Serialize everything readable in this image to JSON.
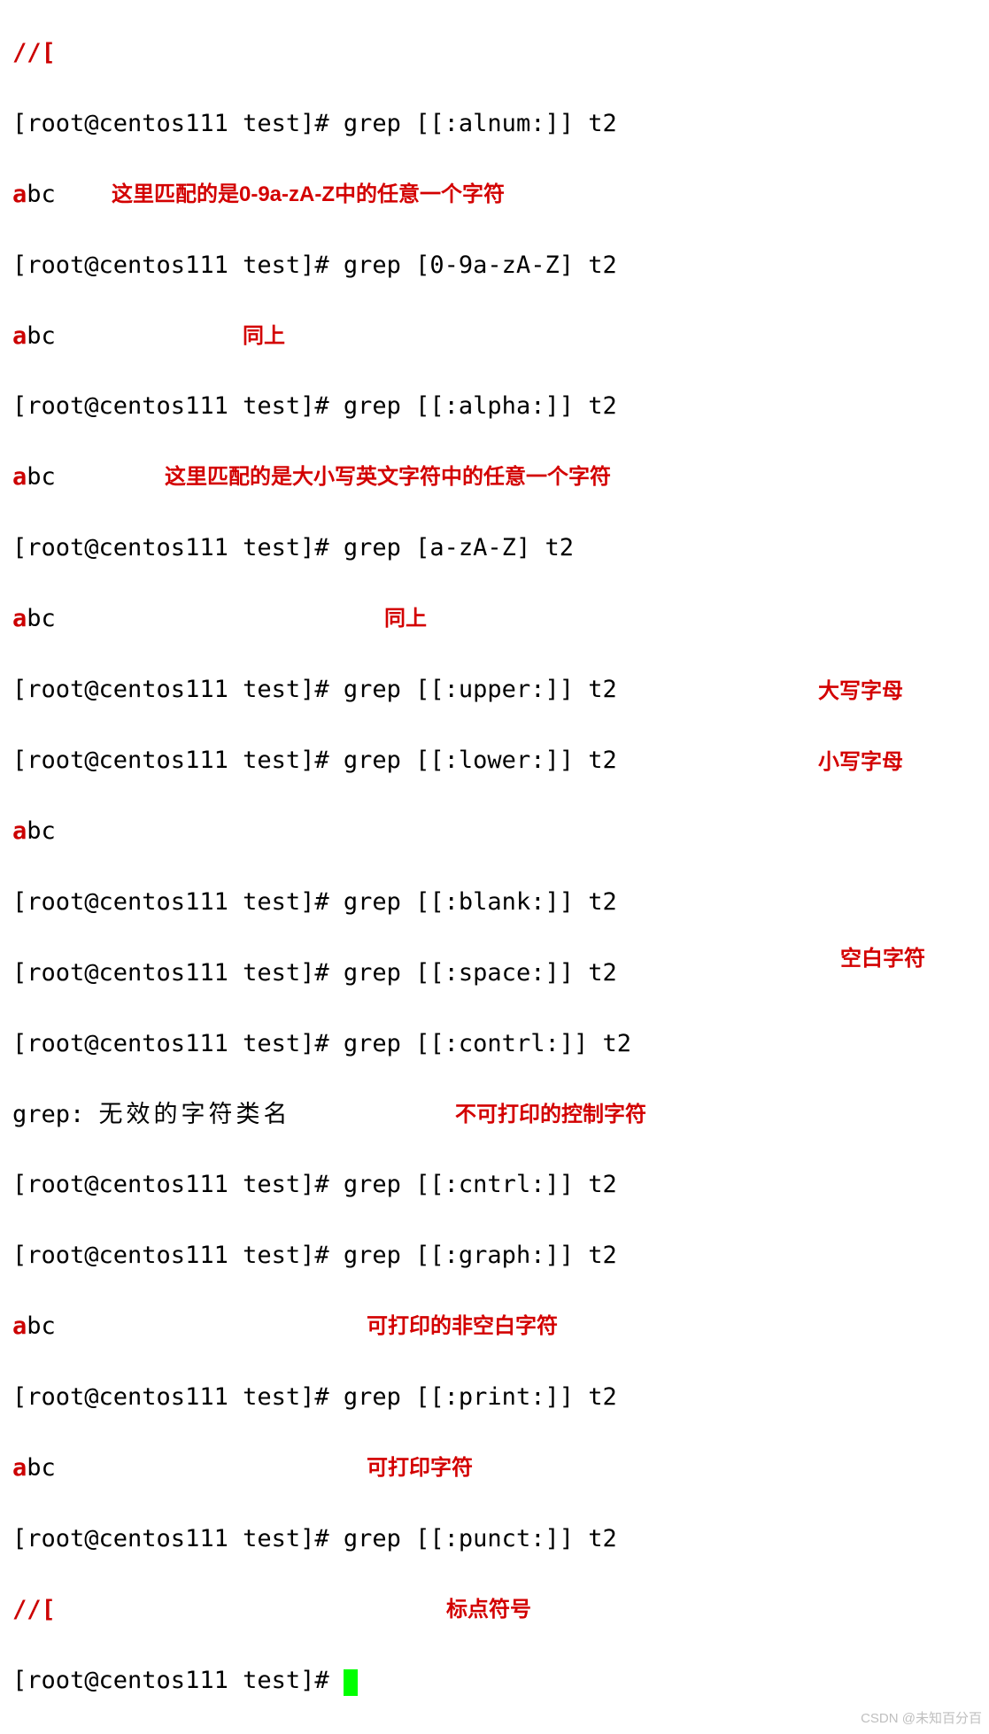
{
  "lines": {
    "l0": "//[",
    "l1": "[root@centos111 test]# grep [[:alnum:]] t2",
    "l2a": "a",
    "l2b": "bc",
    "l3": "[root@centos111 test]# grep [0-9a-zA-Z] t2",
    "l4a": "a",
    "l4b": "bc",
    "l5": "[root@centos111 test]# grep [[:alpha:]] t2",
    "l6a": "a",
    "l6b": "bc",
    "l7": "[root@centos111 test]# grep [a-zA-Z] t2",
    "l8a": "a",
    "l8b": "bc",
    "l9": "[root@centos111 test]# grep [[:upper:]] t2",
    "l10": "[root@centos111 test]# grep [[:lower:]] t2",
    "l11a": "a",
    "l11b": "bc",
    "l12": "[root@centos111 test]# grep [[:blank:]] t2",
    "l13": "[root@centos111 test]# grep [[:space:]] t2",
    "l14": "[root@centos111 test]# grep [[:contrl:]] t2",
    "l15a": "grep: ",
    "l15b": "无效的字符类名",
    "l16": "[root@centos111 test]# grep [[:cntrl:]] t2",
    "l17": "[root@centos111 test]# grep [[:graph:]] t2",
    "l18a": "a",
    "l18b": "bc",
    "l19": "[root@centos111 test]# grep [[:print:]] t2",
    "l20a": "a",
    "l20b": "bc",
    "l21": "[root@centos111 test]# grep [[:punct:]] t2",
    "l22": "//[",
    "l23": "[root@centos111 test]# "
  },
  "annotations": {
    "a1": "这里匹配的是0-9a-zA-Z中的任意一个字符",
    "a2": "同上",
    "a3": "这里匹配的是大小写英文字符中的任意一个字符",
    "a4": "同上",
    "a5": "大写字母",
    "a6": "小写字母",
    "a7": "空白字符",
    "a8": "不可打印的控制字符",
    "a9": "可打印的非空白字符",
    "a10": "可打印字符",
    "a11": "标点符号"
  },
  "watermark": "CSDN @未知百分百"
}
